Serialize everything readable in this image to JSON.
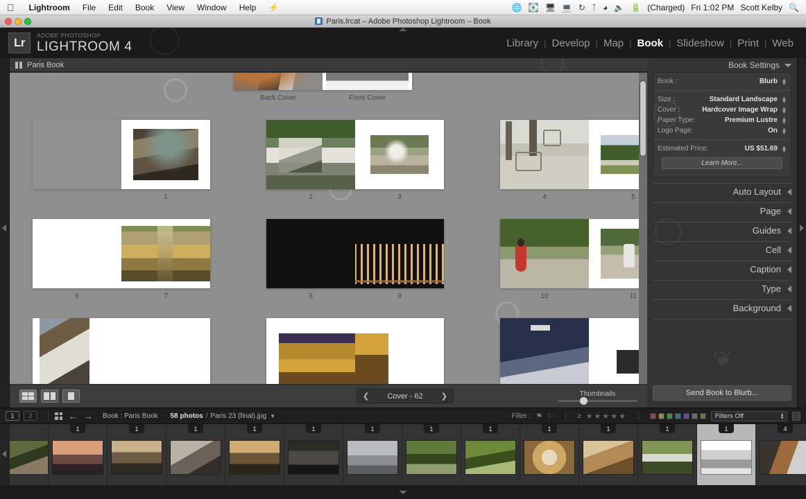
{
  "os_menu": {
    "apple_icon": "apple-icon",
    "items": [
      "Lightroom",
      "File",
      "Edit",
      "Book",
      "View",
      "Window",
      "Help"
    ],
    "app_name": "Lightroom",
    "extras_icons": [
      "globe-icon",
      "drive-icon",
      "eject-icon",
      "display-icon",
      "timemachine-icon",
      "bluetooth-icon",
      "wifi-icon",
      "volume-icon",
      "battery-icon"
    ],
    "battery_status": "(Charged)",
    "clock": "Fri 1:02 PM",
    "user": "Scott Kelby",
    "search_icon": "spotlight-search-icon"
  },
  "window": {
    "title": "Paris.lrcat – Adobe Photoshop Lightroom – Book",
    "doc_icon": "document-icon",
    "traffic": [
      "close",
      "minimize",
      "zoom"
    ]
  },
  "identity": {
    "badge": "Lr",
    "brand_small": "ADOBE PHOTOSHOP",
    "brand_large": "LIGHTROOM 4",
    "modules": [
      {
        "label": "Library",
        "active": false
      },
      {
        "label": "Develop",
        "active": false
      },
      {
        "label": "Map",
        "active": false
      },
      {
        "label": "Book",
        "active": true
      },
      {
        "label": "Slideshow",
        "active": false
      },
      {
        "label": "Print",
        "active": false
      },
      {
        "label": "Web",
        "active": false
      }
    ],
    "separator": "|"
  },
  "center": {
    "book_header_title": "Paris Book",
    "header_icon": "panel-group-icon",
    "covers": {
      "back": "Back Cover",
      "front": "Front Cover"
    },
    "spreads": [
      {
        "labels": [
          "1"
        ],
        "pages": 2
      },
      {
        "labels": [
          "2",
          "3"
        ],
        "pages": 2
      },
      {
        "labels": [
          "4",
          "5"
        ],
        "pages": 2
      },
      {
        "labels": [
          "6",
          "7"
        ],
        "pages": 2
      },
      {
        "labels": [
          "8",
          "9"
        ],
        "pages": 2
      },
      {
        "labels": [
          "10",
          "11"
        ],
        "pages": 2
      }
    ]
  },
  "toolbar": {
    "view_multipage_icon": "multi-page-view-icon",
    "view_spread_icon": "spread-view-icon",
    "view_single_icon": "single-page-view-icon",
    "page_nav": {
      "prev_icon": "chevron-left-icon",
      "label": "Cover - 62",
      "next_icon": "chevron-right-icon"
    },
    "thumbnails_label": "Thumbnails",
    "thumbnails_value": 30
  },
  "right_panel": {
    "book_settings": {
      "title": "Book Settings",
      "disclosure_icon": "triangle-down-icon",
      "rows": [
        {
          "key": "Book :",
          "value": "Blurb",
          "stepper": "stepper-icon"
        },
        {
          "key": "Size :",
          "value": "Standard Landscape",
          "stepper": "stepper-icon"
        },
        {
          "key": "Cover :",
          "value": "Hardcover Image Wrap",
          "stepper": "stepper-icon"
        },
        {
          "key": "Paper Type:",
          "value": "Premium Lustre",
          "stepper": "stepper-icon"
        },
        {
          "key": "Logo Page:",
          "value": "On",
          "stepper": "stepper-icon"
        },
        {
          "key": "Estimated Price:",
          "value": "US $51.69",
          "stepper": "stepper-icon"
        }
      ],
      "learn_more": "Learn More..."
    },
    "sections": [
      {
        "label": "Auto Layout",
        "icon": "triangle-left-icon"
      },
      {
        "label": "Page",
        "icon": "triangle-left-icon"
      },
      {
        "label": "Guides",
        "icon": "triangle-left-icon"
      },
      {
        "label": "Cell",
        "icon": "triangle-left-icon"
      },
      {
        "label": "Caption",
        "icon": "triangle-left-icon"
      },
      {
        "label": "Type",
        "icon": "triangle-left-icon"
      },
      {
        "label": "Background",
        "icon": "triangle-left-icon"
      }
    ],
    "send_button": "Send Book to Blurb..."
  },
  "filmstrip_bar": {
    "page_buttons": [
      "1",
      "2"
    ],
    "grid_icon": "grid-view-icon",
    "back_icon": "arrow-left-icon",
    "forward_icon": "arrow-right-icon",
    "source": "Book : Paris Book",
    "photo_count": "58 photos",
    "separator": "/",
    "filename": "Paris 23 (final).jpg",
    "caret_icon": "chevron-down-icon",
    "filter_label": "Filter :",
    "flag_icon": "flag-icon",
    "reject_icon": "reject-flag-icon",
    "rating_prefix": "≥",
    "stars": "★★★★★",
    "color_swatches": [
      "#8a4a4a",
      "#8a8a4a",
      "#4a8a4a",
      "#4a6a8a",
      "#6a4a8a",
      "#6a6a6a",
      "#7a6a4a"
    ],
    "filters_off": "Filters Off",
    "stepper_icon": "stepper-icon",
    "lock_icon": "lock-icon"
  },
  "filmstrip": {
    "collapse_icon": "triangle-left-icon",
    "cells": [
      {
        "badge": "",
        "selected": false,
        "name": "photo-portrait-green",
        "c1": "#5b6b3e",
        "c2": "#2f3a22",
        "c3": "#8b7a63"
      },
      {
        "badge": "1",
        "selected": false,
        "name": "photo-bridge-sunset",
        "c1": "#d7a07a",
        "c2": "#6b4a44",
        "c3": "#2b2024"
      },
      {
        "badge": "1",
        "selected": false,
        "name": "photo-cathedral-nave-a",
        "c1": "#c8b08a",
        "c2": "#6d5a42",
        "c3": "#2e2a22"
      },
      {
        "badge": "1",
        "selected": false,
        "name": "photo-cathedral-interior-b",
        "c1": "#b9b2a4",
        "c2": "#6a6258",
        "c3": "#332e2a"
      },
      {
        "badge": "1",
        "selected": false,
        "name": "photo-cathedral-nave-c",
        "c1": "#d0ab72",
        "c2": "#6b5336",
        "c3": "#2d241c"
      },
      {
        "badge": "1",
        "selected": false,
        "name": "photo-chalkboard-menu",
        "c1": "#2a2a26",
        "c2": "#4a4a42",
        "c3": "#161614"
      },
      {
        "badge": "1",
        "selected": false,
        "name": "photo-palace-facade",
        "c1": "#b9bcc2",
        "c2": "#8a8d92",
        "c3": "#5c5f63"
      },
      {
        "badge": "1",
        "selected": false,
        "name": "photo-garden-arch",
        "c1": "#5f7a3c",
        "c2": "#34471f",
        "c3": "#8f9c6c"
      },
      {
        "badge": "1",
        "selected": false,
        "name": "photo-green-produce",
        "c1": "#6d8a3a",
        "c2": "#3b4f1c",
        "c3": "#a8b877"
      },
      {
        "badge": "1",
        "selected": false,
        "name": "photo-food-plate",
        "c1": "#cfa765",
        "c2": "#8a6a3c",
        "c3": "#e6d9c0"
      },
      {
        "badge": "1",
        "selected": false,
        "name": "photo-bread-basket",
        "c1": "#b38a56",
        "c2": "#6d4f2c",
        "c3": "#d9c39b"
      },
      {
        "badge": "1",
        "selected": false,
        "name": "photo-motorcycle",
        "c1": "#7f9455",
        "c2": "#3d4a26",
        "c3": "#d8d8d0"
      },
      {
        "badge": "1",
        "selected": true,
        "name": "photo-notre-dame-bw",
        "c1": "#e9e9e9",
        "c2": "#bdbdbd",
        "c3": "#8e8e8e"
      },
      {
        "badge": "4",
        "selected": false,
        "name": "photo-cellist",
        "c1": "#9c6a3c",
        "c2": "#3a3430",
        "c3": "#cfcfcf"
      }
    ]
  },
  "colors": {
    "canvas_bg": "#8f8f8f",
    "panel_bg": "#333333",
    "accent_text": "#ffffff",
    "selected_cell": "#b8b8b8"
  }
}
